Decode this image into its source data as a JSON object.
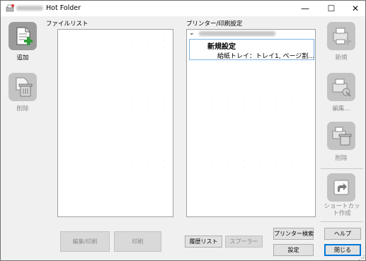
{
  "window": {
    "title": "Hot Folder",
    "minimize": "—",
    "maximize": "☐",
    "close": "✕"
  },
  "left_toolbar": {
    "add_label": "追加",
    "delete_label": "削除"
  },
  "file_list": {
    "label": "ファイルリスト"
  },
  "printer_settings": {
    "label": "プリンター/印刷設定",
    "expander": "⌄",
    "new_setting_name": "新規設定",
    "new_setting_detail": "給紙トレイ：トレイ1, ページ割..."
  },
  "right_toolbar": {
    "new_label": "新規",
    "edit_label": "編集...",
    "delete_label": "削除",
    "shortcut_label": "ショートカット作成"
  },
  "bottom_buttons": {
    "edit_print": "編集/印刷",
    "print": "印刷",
    "history_list": "履歴リスト",
    "spooler": "スプーラー",
    "printer_search": "プリンター検索",
    "settings": "設定",
    "help": "ヘルプ",
    "close": "閉じる"
  },
  "colors": {
    "active_icon_bg": "#9b9b9b",
    "disabled_icon_bg": "#c3c3c3",
    "plus_green": "#2e9e3a",
    "selection_border": "#7fb4e2",
    "default_button_border": "#0078d7"
  }
}
